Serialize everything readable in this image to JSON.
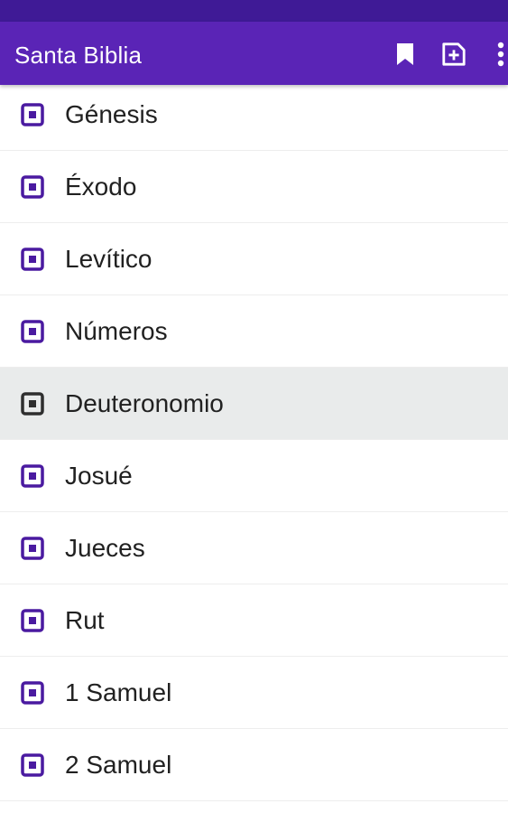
{
  "app_bar": {
    "title": "Santa Biblia",
    "actions": [
      {
        "icon": "bookmark-icon"
      },
      {
        "icon": "add-note-icon"
      },
      {
        "icon": "more-vert-icon"
      }
    ]
  },
  "colors": {
    "primary": "#5a24b6",
    "status_bar": "#3f1a96",
    "icon_accent": "#4a1aa0",
    "selected_row": "#e9ebeb",
    "selected_icon": "#2e2e2e"
  },
  "books": [
    {
      "label": "Génesis",
      "selected": false
    },
    {
      "label": "Éxodo",
      "selected": false
    },
    {
      "label": "Levítico",
      "selected": false
    },
    {
      "label": "Números",
      "selected": false
    },
    {
      "label": "Deuteronomio",
      "selected": true
    },
    {
      "label": "Josué",
      "selected": false
    },
    {
      "label": "Jueces",
      "selected": false
    },
    {
      "label": "Rut",
      "selected": false
    },
    {
      "label": "1 Samuel",
      "selected": false
    },
    {
      "label": "2 Samuel",
      "selected": false
    }
  ]
}
